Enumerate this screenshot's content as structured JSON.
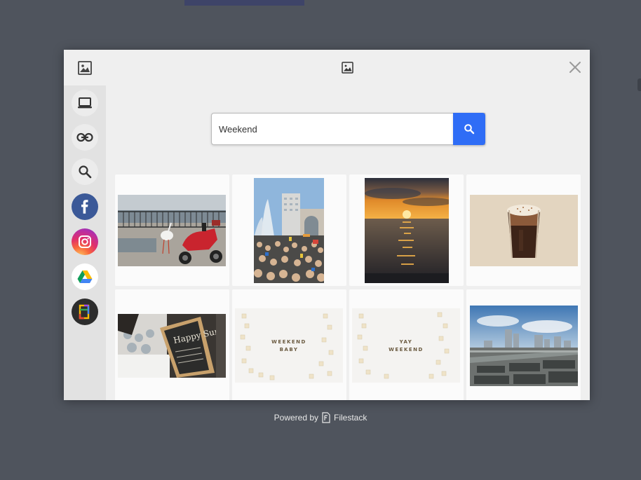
{
  "search": {
    "value": "Weekend"
  },
  "sidebar": {
    "items": [
      {
        "name": "My Device",
        "icon": "laptop-icon"
      },
      {
        "name": "Link",
        "icon": "link-icon"
      },
      {
        "name": "Web Search",
        "icon": "search-icon"
      },
      {
        "name": "Facebook",
        "icon": "facebook-icon"
      },
      {
        "name": "Instagram",
        "icon": "instagram-icon"
      },
      {
        "name": "Google Drive",
        "icon": "google-drive-icon"
      },
      {
        "name": "Google Photos",
        "icon": "google-photos-icon"
      }
    ]
  },
  "results": [
    {
      "subject": "stork and red scooter on seaside promenade"
    },
    {
      "subject": "crowd at city plaza fountain"
    },
    {
      "subject": "orange sunset over the sea"
    },
    {
      "subject": "iced coffee in plastic cup"
    },
    {
      "subject": "chalkboard sign at outdoor cafe",
      "sign_text": "Happy Sun"
    },
    {
      "subject": "scrabble tiles spelling weekend baby",
      "text": [
        "WEEKEND",
        "BABY"
      ]
    },
    {
      "subject": "scrabble tiles spelling yay weekend",
      "text": [
        "YAY",
        "WEEKEND"
      ]
    },
    {
      "subject": "city skyline aerial view"
    }
  ],
  "footer": {
    "powered_by": "Powered by",
    "brand": "Filestack"
  },
  "colors": {
    "backdrop": "#4f545d",
    "modal_bg": "#efefef",
    "sidebar_bg": "#e2e2e2",
    "search_button": "#2f6df6",
    "facebook": "#3b5998",
    "google_photos_bg": "#2d2d2d"
  }
}
